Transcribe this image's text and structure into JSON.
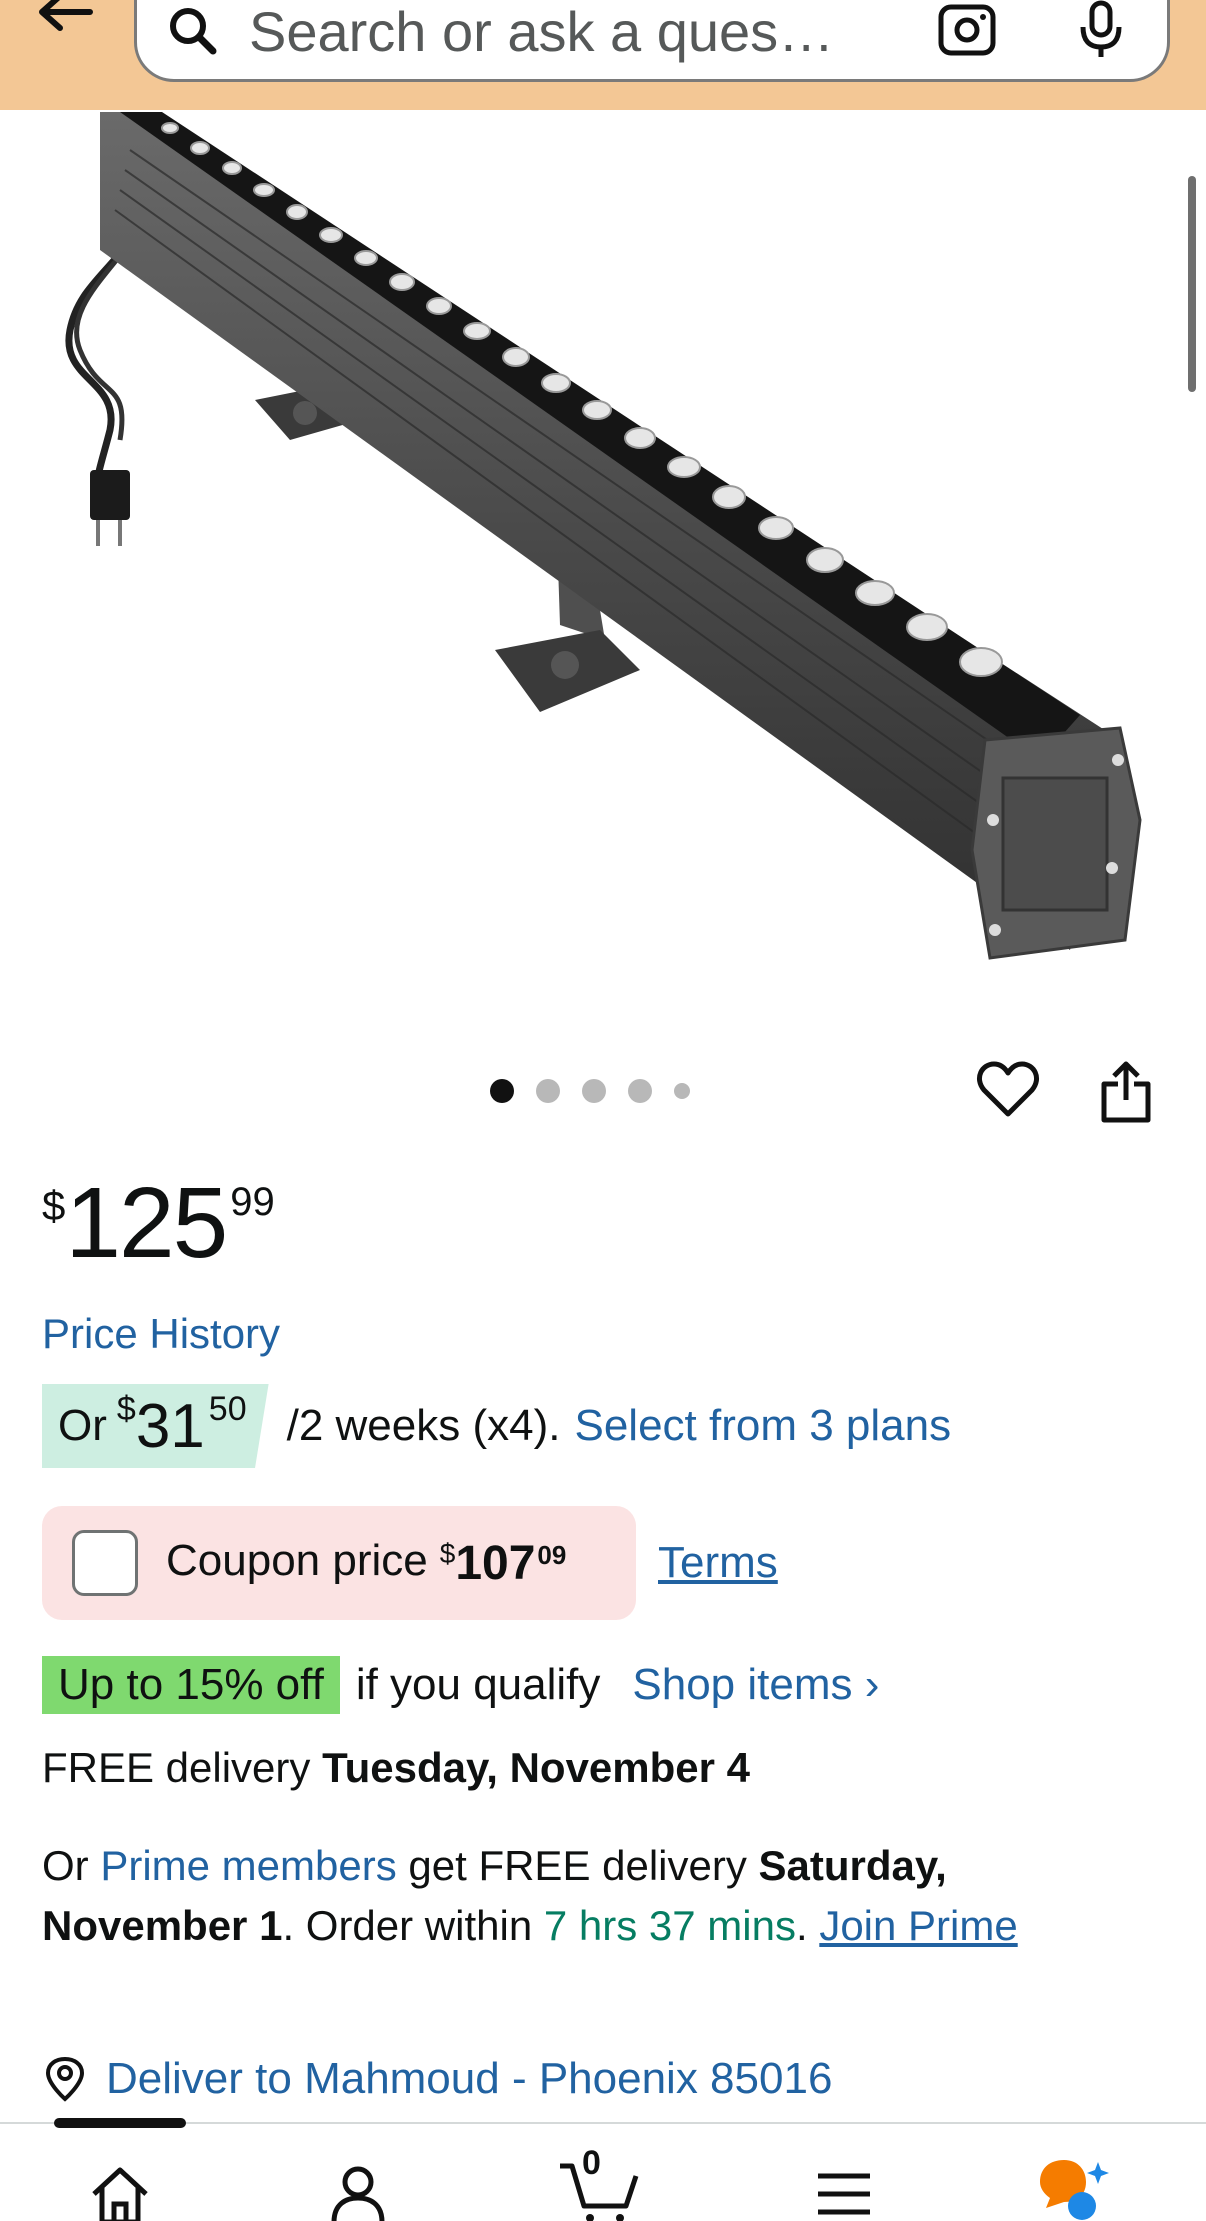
{
  "search": {
    "placeholder": "Search or ask a ques…",
    "icons": [
      "back-arrow-icon",
      "search-icon",
      "camera-lens-icon",
      "microphone-icon"
    ]
  },
  "carousel": {
    "count": 5,
    "active_index": 0
  },
  "actions": {
    "icons": [
      "heart-icon",
      "share-icon"
    ]
  },
  "price": {
    "symbol": "$",
    "whole": "125",
    "fraction": "99"
  },
  "price_history": "Price History",
  "installment": {
    "prefix": "Or",
    "symbol": "$",
    "whole": "31",
    "fraction": "50",
    "terms": "/2 weeks (x4).",
    "plans_link": "Select from 3 plans"
  },
  "coupon": {
    "label": "Coupon price",
    "symbol": "$",
    "whole": "107",
    "fraction": "09",
    "terms_link": "Terms",
    "checked": false
  },
  "discount": {
    "badge": "Up to 15% off",
    "text": "if you qualify",
    "shop_link": "Shop items",
    "shop_chevron": "›"
  },
  "delivery": {
    "prefix": "FREE delivery",
    "date": "Tuesday, November 4"
  },
  "prime": {
    "or": "Or",
    "members_link": "Prime members",
    "text1": "get FREE delivery",
    "date": "Saturday, November 1",
    "text2": ". Order within",
    "countdown": "7 hrs 37 mins",
    "period": ".",
    "join_link": "Join Prime"
  },
  "deliver_to": "Deliver to Mahmoud - Phoenix 85016",
  "nav": {
    "cart_count": "0",
    "icons": [
      "home-icon",
      "account-icon",
      "cart-icon",
      "menu-icon",
      "assistant-icon"
    ]
  },
  "colors": {
    "header_bg": "#f3c795",
    "link": "#2162a1",
    "installment_highlight": "#cdeee1",
    "coupon_bg": "#fbe3e3",
    "discount_badge": "#7fd96f",
    "countdown_green": "#067d62",
    "assistant_orange": "#f57c00",
    "assistant_blue": "#1e88e5"
  }
}
